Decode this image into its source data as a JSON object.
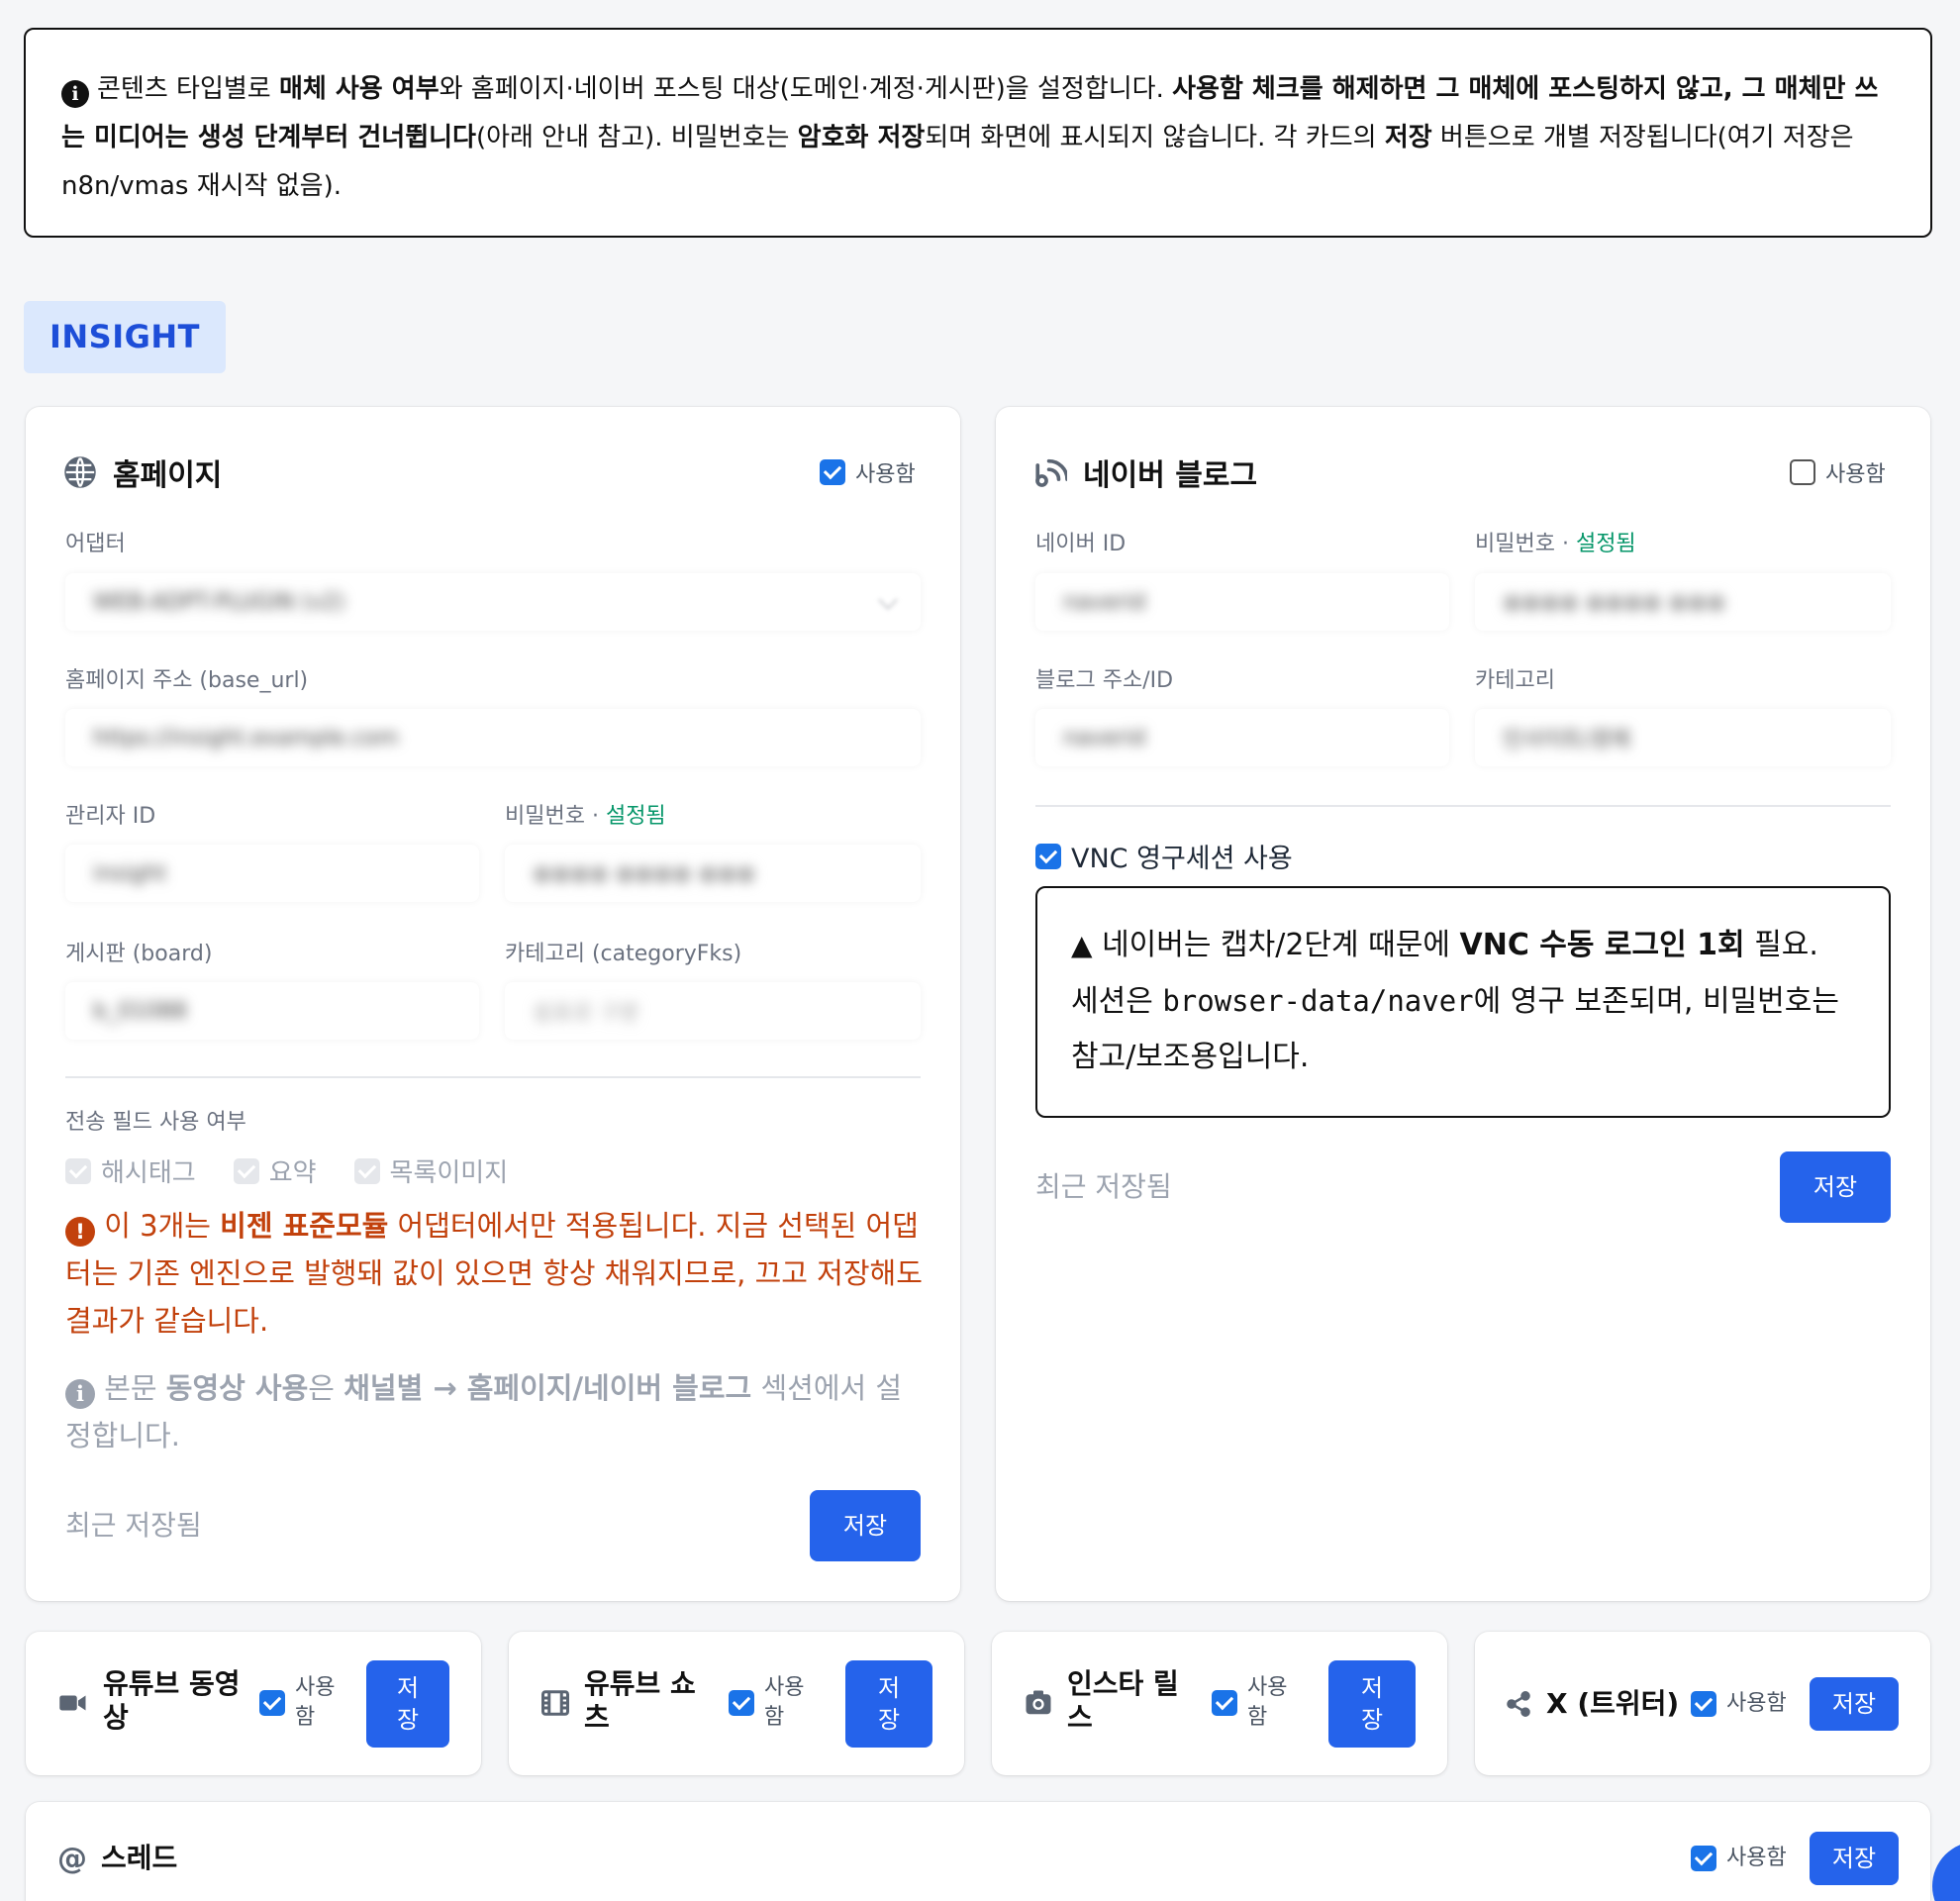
{
  "notice": {
    "intro": "콘텐츠 타입별로 ",
    "b1": "매체 사용 여부",
    "t2": "와 홈페이지·네이버 포스팅 대상(도메인·계정·게시판)을 설정합니다. ",
    "b2": "사용함 체크를 해제하면 그 매체에 포스팅하지 않고, 그 매체만 쓰는 미디어는 생성 단계부터 건너뜁니다",
    "t3": "(아래 안내 참고). 비밀번호는 ",
    "b3": "암호화 저장",
    "t4": "되며 화면에 표시되지 않습니다. 각 카드의 ",
    "b4": "저장",
    "t5": " 버튼으로 개별 저장됩니다(여기 저장은 n8n/vmas 재시작 없음)."
  },
  "section_tag": "INSIGHT",
  "homepage": {
    "title": "홈페이지",
    "use_label": "사용함",
    "use_checked": true,
    "adapter_label": "어댑터",
    "adapter_value": "WEB-ADPT-PLUGIN (v2)",
    "base_url_label": "홈페이지 주소 (base_url)",
    "base_url_value": "https://insight.example.com",
    "admin_id_label": "관리자 ID",
    "admin_id_value": "insight",
    "password_label": "비밀번호 · ",
    "password_status": "설정됨",
    "password_placeholder": "●●●● ●●●● ●●●",
    "board_label": "게시판 (board)",
    "board_value": "b_01088",
    "category_label": "카테고리 (categoryFks)",
    "category_value": "쉼표로 구분",
    "send_fields_label": "전송 필드 사용 여부",
    "send_fields": [
      "해시태그",
      "요약",
      "목록이미지"
    ],
    "warn_pre": " 이 3개는 ",
    "warn_bold": "비젠 표준모듈",
    "warn_post": " 어댑터에서만 적용됩니다. 지금 선택된 어댑터는 기존 엔진으로 발행돼 값이 있으면 항상 채워지므로, 끄고 저장해도 결과가 같습니다.",
    "info_pre": " 본문 ",
    "info_b1": "동영상 사용",
    "info_mid": "은 ",
    "info_b2": "채널별 → 홈페이지/네이버 블로그",
    "info_post": " 섹션에서 설정합니다.",
    "saved_text": "최근 저장됨",
    "save_button": "저장"
  },
  "naver": {
    "title": "네이버 블로그",
    "use_label": "사용함",
    "use_checked": false,
    "id_label": "네이버 ID",
    "id_value": "naverid",
    "password_label": "비밀번호 · ",
    "password_status": "설정됨",
    "password_placeholder": "●●●● ●●●● ●●●",
    "blog_label": "블로그 주소/ID",
    "blog_value": "naverid",
    "category_label": "카테고리",
    "category_value": "인사이트/경제",
    "vnc_label": "VNC 영구세션 사용",
    "vnc_checked": true,
    "vnc_t1": " 네이버는 캡차/2단계 때문에 ",
    "vnc_b1": "VNC 수동 로그인 1회",
    "vnc_t2": " 필요. 세션은 ",
    "vnc_code": "browser-data/naver",
    "vnc_t3": "에 영구 보존되며, 비밀번호는 참고/보조용입니다.",
    "saved_text": "최근 저장됨",
    "save_button": "저장"
  },
  "mini_cards": [
    {
      "title": "유튜브 동영상",
      "icon": "video-camera-icon",
      "use_label": "사용함",
      "save_button": "저장"
    },
    {
      "title": "유튜브 쇼츠",
      "icon": "film-icon",
      "use_label": "사용함",
      "save_button": "저장"
    },
    {
      "title": "인스타 릴스",
      "icon": "camera-icon",
      "use_label": "사용함",
      "save_button": "저장"
    },
    {
      "title": "X (트위터)",
      "icon": "share-icon",
      "use_label": "사용함",
      "save_button": "저장"
    }
  ],
  "threads": {
    "title": "스레드",
    "icon": "at-sign-icon",
    "use_label": "사용함",
    "save_button": "저장"
  },
  "colors": {
    "accent": "#2563eb",
    "ok": "#059669",
    "warn": "#c2410c",
    "tag_bg": "#dbe8fd"
  }
}
